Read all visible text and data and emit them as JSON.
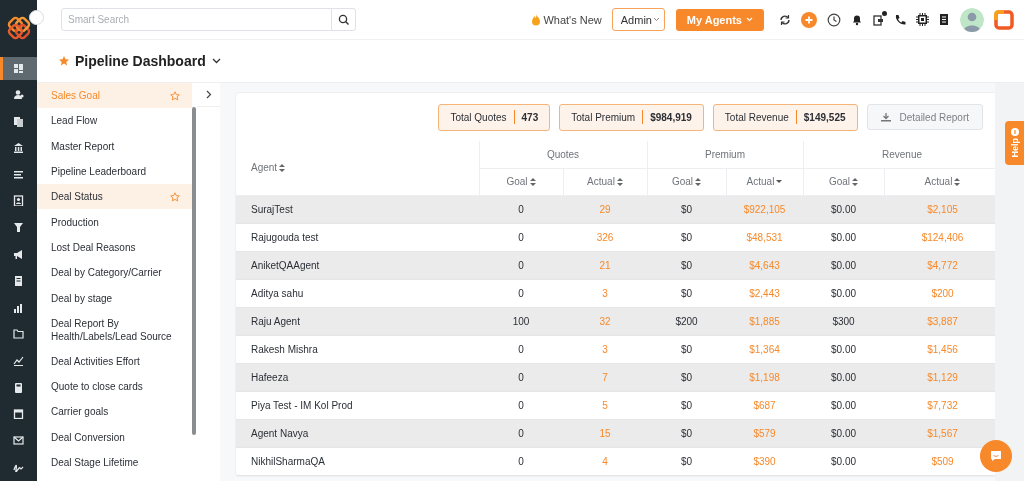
{
  "topbar": {
    "search": {
      "placeholder": "Smart Search"
    },
    "whats_new": "What's New",
    "role_select": {
      "value": "Admin"
    },
    "agents_button": "My Agents",
    "notification_dot": true
  },
  "nav_items": [
    {
      "selected": true
    },
    {
      "selected": false
    },
    {
      "selected": false
    },
    {
      "selected": false
    },
    {
      "selected": false
    },
    {
      "selected": false
    },
    {
      "selected": false
    },
    {
      "selected": false
    },
    {
      "selected": false
    },
    {
      "selected": false
    },
    {
      "selected": false
    },
    {
      "selected": false
    },
    {
      "selected": false
    },
    {
      "selected": false
    },
    {
      "selected": false
    },
    {
      "selected": false
    }
  ],
  "page": {
    "title": "Pipeline Dashboard",
    "starred": true
  },
  "reports": [
    {
      "label": "Sales Goal",
      "selected": true,
      "hovered": false,
      "starred": true
    },
    {
      "label": "Lead Flow",
      "selected": false,
      "hovered": false,
      "starred": false
    },
    {
      "label": "Master Report",
      "selected": false,
      "hovered": false,
      "starred": false
    },
    {
      "label": "Pipeline Leaderboard",
      "selected": false,
      "hovered": false,
      "starred": false
    },
    {
      "label": "Deal Status",
      "selected": false,
      "hovered": true,
      "starred": true
    },
    {
      "label": "Production",
      "selected": false,
      "hovered": false,
      "starred": false
    },
    {
      "label": "Lost Deal Reasons",
      "selected": false,
      "hovered": false,
      "starred": false
    },
    {
      "label": "Deal by Category/Carrier",
      "selected": false,
      "hovered": false,
      "starred": false
    },
    {
      "label": "Deal by stage",
      "selected": false,
      "hovered": false,
      "starred": false
    },
    {
      "label": "Deal Report By Health/Labels/Lead Source",
      "selected": false,
      "hovered": false,
      "starred": false
    },
    {
      "label": "Deal Activities Effort",
      "selected": false,
      "hovered": false,
      "starred": false
    },
    {
      "label": "Quote to close cards",
      "selected": false,
      "hovered": false,
      "starred": false
    },
    {
      "label": "Carrier goals",
      "selected": false,
      "hovered": false,
      "starred": false
    },
    {
      "label": "Deal Conversion",
      "selected": false,
      "hovered": false,
      "starred": false
    },
    {
      "label": "Deal Stage Lifetime",
      "selected": false,
      "hovered": false,
      "starred": false
    }
  ],
  "totals": [
    {
      "label": "Total Quotes",
      "value": "473"
    },
    {
      "label": "Total Premium",
      "value": "$984,919"
    },
    {
      "label": "Total Revenue",
      "value": "$149,525"
    }
  ],
  "detailed_report_button": "Detailed Report",
  "table": {
    "agent_column": {
      "label": "Agent",
      "sorted": false
    },
    "groups": [
      {
        "label": "Quotes",
        "columns": [
          {
            "label": "Goal",
            "sorted": false
          },
          {
            "label": "Actual",
            "sorted": false
          }
        ]
      },
      {
        "label": "Premium",
        "columns": [
          {
            "label": "Goal",
            "sorted": false
          },
          {
            "label": "Actual",
            "sorted": true
          }
        ]
      },
      {
        "label": "Revenue",
        "columns": [
          {
            "label": "Goal",
            "sorted": false
          },
          {
            "label": "Actual",
            "sorted": false
          }
        ]
      }
    ],
    "rows": [
      [
        "SurajTest",
        "0",
        "29",
        "$0",
        "$922,105",
        "$0.00",
        "$2,105"
      ],
      [
        "Rajugouda test",
        "0",
        "326",
        "$0",
        "$48,531",
        "$0.00",
        "$124,406"
      ],
      [
        "AniketQAAgent",
        "0",
        "21",
        "$0",
        "$4,643",
        "$0.00",
        "$4,772"
      ],
      [
        "Aditya sahu",
        "0",
        "3",
        "$0",
        "$2,443",
        "$0.00",
        "$200"
      ],
      [
        "Raju Agent",
        "100",
        "32",
        "$200",
        "$1,885",
        "$300",
        "$3,887"
      ],
      [
        "Rakesh Mishra",
        "0",
        "3",
        "$0",
        "$1,364",
        "$0.00",
        "$1,456"
      ],
      [
        "Hafeeza",
        "0",
        "7",
        "$0",
        "$1,198",
        "$0.00",
        "$1,129"
      ],
      [
        "Piya Test - IM Kol Prod",
        "0",
        "5",
        "$0",
        "$687",
        "$0.00",
        "$7,732"
      ],
      [
        "Agent Navya",
        "0",
        "15",
        "$0",
        "$579",
        "$0.00",
        "$1,567"
      ],
      [
        "NikhilSharmaQA",
        "0",
        "4",
        "$0",
        "$390",
        "$0.00",
        "$509"
      ]
    ]
  },
  "help_tab": "Help"
}
